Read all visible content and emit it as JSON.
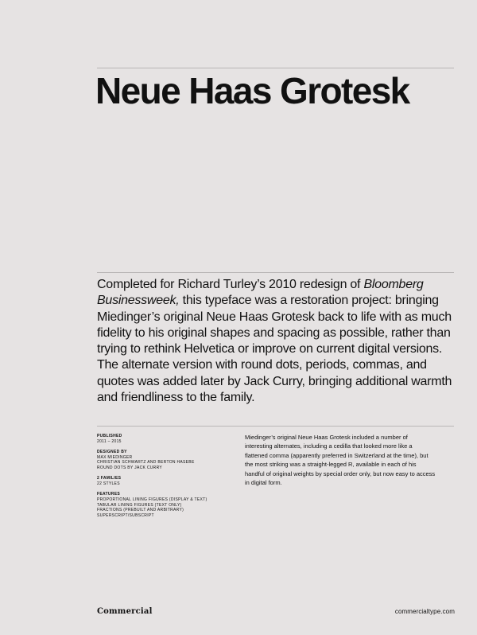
{
  "title": "Neue Haas Grotesk",
  "intro": {
    "part1": "Completed for Richard Turley’s 2010 redesign of ",
    "italic1": "Bloomberg",
    "italic2": "Businessweek,",
    "part2": " this typeface was a restoration project: bringing Miedinger’s original Neue Haas Grotesk back to life with as much fidelity to his original shapes and spacing as possible, rather than trying to rethink Helvetica or improve on current digital versions. The alternate version with round dots, periods, commas, and quotes was added later by Jack Curry, bringing additional warmth and friendliness to the family."
  },
  "meta": {
    "published": {
      "heading": "Published",
      "value": "2011 – 2015"
    },
    "designed_by": {
      "heading": "Designed by",
      "lines": [
        "Max Miedinger",
        "Christian Schwartz and Berton Hasebe",
        "Round Dots by Jack Curry"
      ]
    },
    "families": {
      "heading": "2 Families",
      "value": "22 Styles"
    },
    "features": {
      "heading": "Features",
      "lines": [
        "Proportional Lining Figures (Display & Text)",
        "Tabular Lining Figures (Text Only)",
        "Fractions (Prebuilt and Arbitrary)",
        "Superscript/Subscript"
      ]
    }
  },
  "body_copy": "Miedinger’s original Neue Haas Grotesk included a number of interesting alternates, including a cedilla that looked more like a flattened comma (apparently preferred in Switzerland at the time), but the most striking was a straight-legged R, available in each of his handful of original weights by special order only, but now easy to access in digital form.",
  "footer": {
    "logo": "Commercial",
    "site": "commercialtype.com"
  },
  "colors": {
    "background": "#e6e3e3",
    "text": "#111111",
    "rule": "#b9b6b6"
  }
}
